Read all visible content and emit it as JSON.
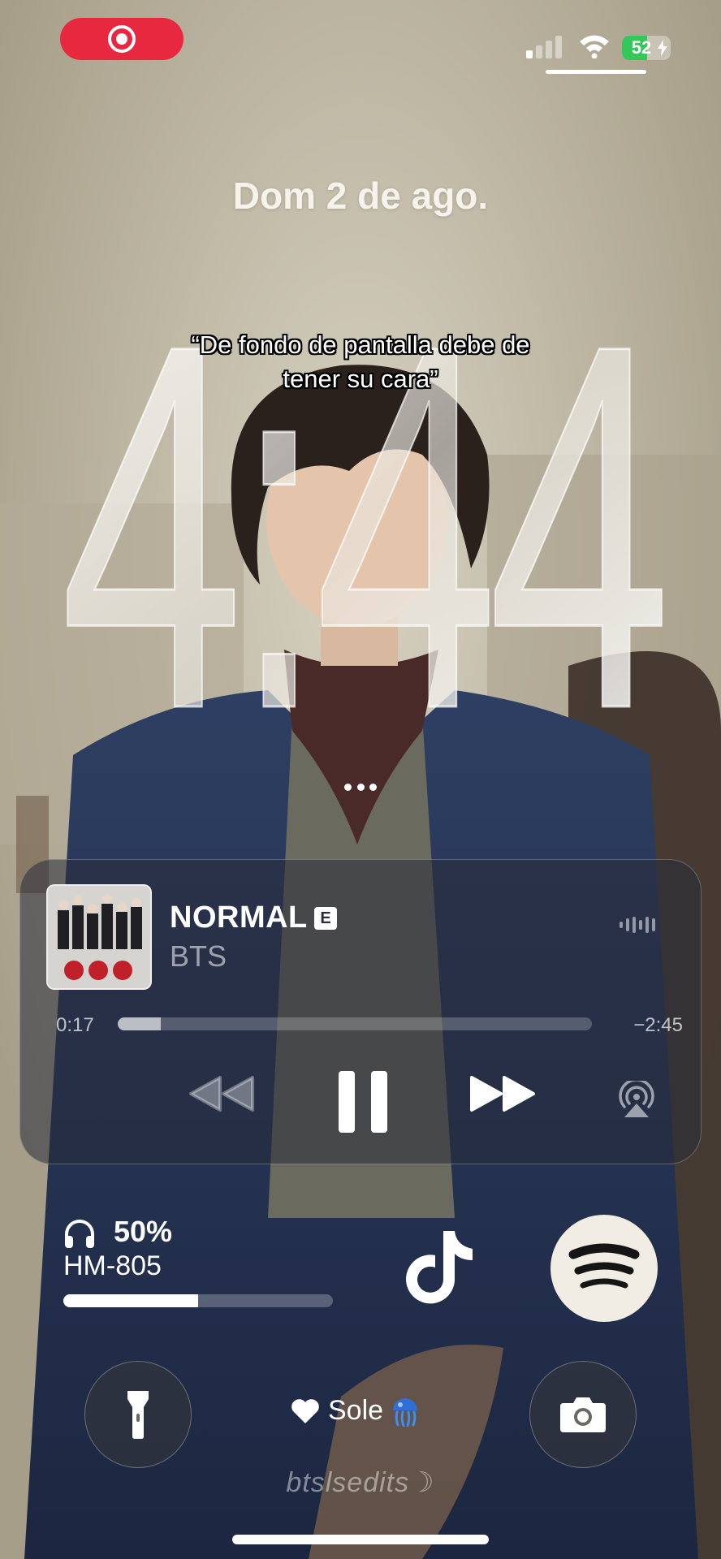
{
  "status_bar": {
    "battery_text": "52",
    "battery_level": 0.52
  },
  "lock_screen": {
    "date": "Dom 2 de ago.",
    "time": "4:44"
  },
  "caption": {
    "line1": "“De fondo de pantalla debe de",
    "line2": "tener su cara”"
  },
  "player": {
    "title": "NORMAL",
    "explicit_badge": "E",
    "artist": "BTS",
    "elapsed": "0:17",
    "remaining": "−2:45",
    "progress": 0.09
  },
  "headphones": {
    "percent_label": "50%",
    "level": 0.5,
    "device_name": "HM-805"
  },
  "focus": {
    "label": "Sole"
  },
  "watermark": "btslsedits☽",
  "colors": {
    "record_red": "#e8283f",
    "battery_green": "#34c759",
    "spotify_bg": "#f2ede4"
  },
  "icons": {
    "record": "record-icon",
    "signal": "cellular-signal-icon",
    "wifi": "wifi-icon",
    "battery": "battery-charging-icon",
    "waveform": "waveform-icon",
    "rewind": "rewind-icon",
    "pause": "pause-icon",
    "forward": "fast-forward-icon",
    "airplay": "airplay-icon",
    "headphones": "headphones-icon",
    "tiktok": "tiktok-icon",
    "spotify": "spotify-icon",
    "flashlight": "flashlight-icon",
    "camera": "camera-icon",
    "heart": "heart-icon",
    "jellyfish": "jellyfish-emoji-icon"
  }
}
